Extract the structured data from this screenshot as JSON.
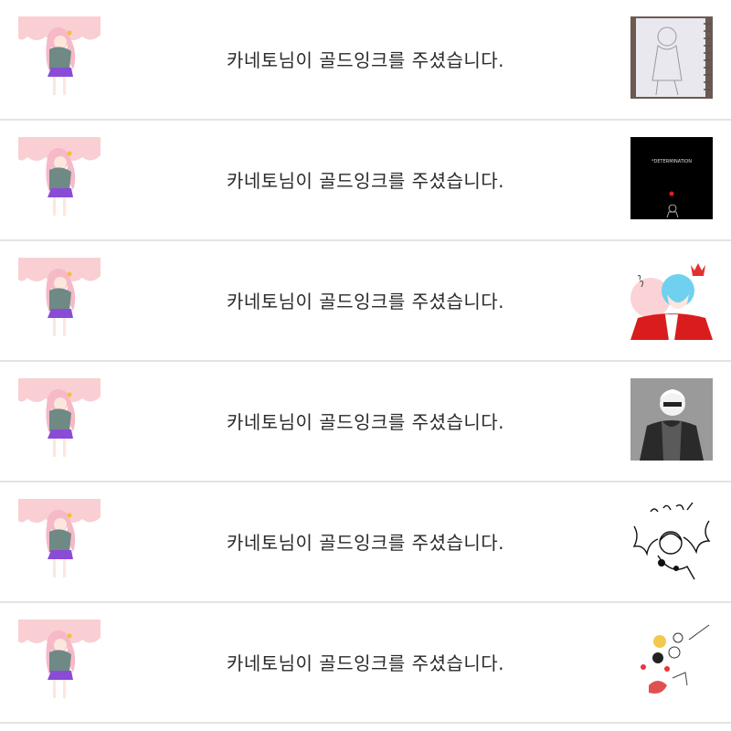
{
  "notifications": [
    {
      "message": "카네토님이 골드잉크를 주셨습니다.",
      "thumbnail_icon": "sketch-notebook-thumbnail"
    },
    {
      "message": "카네토님이 골드잉크를 주셨습니다.",
      "thumbnail_icon": "dark-determination-thumbnail",
      "thumbnail_text": "*DETERMINATION"
    },
    {
      "message": "카네토님이 골드잉크를 주셨습니다.",
      "thumbnail_icon": "king-character-thumbnail"
    },
    {
      "message": "카네토님이 골드잉크를 주셨습니다.",
      "thumbnail_icon": "gray-coat-character-thumbnail"
    },
    {
      "message": "카네토님이 골드잉크를 주셨습니다.",
      "thumbnail_icon": "winged-character-sketch-thumbnail"
    },
    {
      "message": "카네토님이 골드잉크를 주셨습니다.",
      "thumbnail_icon": "doodles-thumbnail"
    }
  ],
  "avatar_icon": "pink-hair-girl-avatar"
}
